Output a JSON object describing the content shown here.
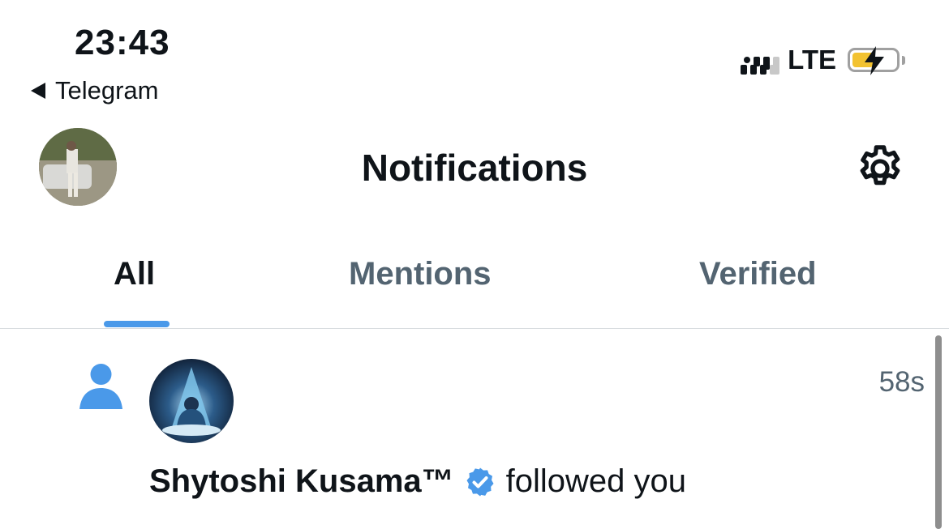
{
  "status_bar": {
    "time": "23:43",
    "back_app": "Telegram",
    "network": "LTE",
    "battery_level": 0.5,
    "battery_color": "#f2c230"
  },
  "header": {
    "title": "Notifications",
    "settings_icon": "gear-icon",
    "avatar": "profile-avatar"
  },
  "tabs": [
    {
      "label": "All",
      "active": true
    },
    {
      "label": "Mentions",
      "active": false
    },
    {
      "label": "Verified",
      "active": false
    }
  ],
  "accent_color": "#4a99e9",
  "notification": {
    "type_icon": "person-icon",
    "user_name": "Shytoshi Kusama™",
    "verified": true,
    "action": "followed you",
    "time_ago": "58s"
  }
}
